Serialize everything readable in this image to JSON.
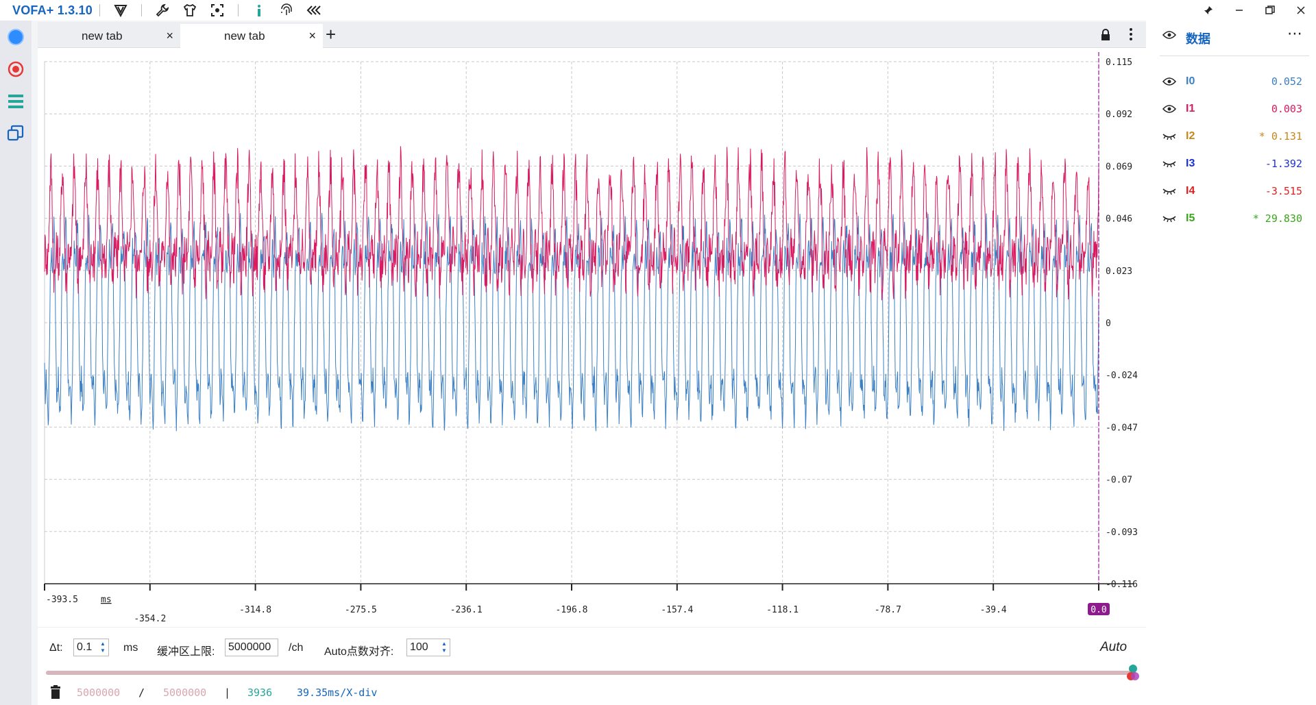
{
  "app": {
    "title": "VOFA+ 1.3.10"
  },
  "toolbar": {
    "icons": [
      "logo-v-icon",
      "wrench-icon",
      "shirt-icon",
      "screenshot-icon",
      "info-icon",
      "fingerprint-icon",
      "collapse-icon"
    ]
  },
  "window_controls": {
    "icons": [
      "pin-icon",
      "minimize-icon",
      "maximize-icon",
      "close-icon"
    ]
  },
  "left_sidebar": {
    "icons": [
      "connect-dot-icon",
      "record-icon",
      "list-icon",
      "windows-icon"
    ]
  },
  "tabs": [
    {
      "label": "new tab",
      "close": "×"
    },
    {
      "label": "new tab",
      "close": "×"
    }
  ],
  "tab_add": "+",
  "tabbar_right": {
    "icons": [
      "lock-icon",
      "more-vertical-icon"
    ]
  },
  "colors": {
    "accent": "#1565c0",
    "i0": "#3b7fc4",
    "i1": "#d81b60",
    "marker": "#8e1b8e",
    "teal": "#26a69a"
  },
  "chart_data": {
    "type": "line",
    "title": "",
    "xlabel": "",
    "x_unit_label": "ms",
    "xlim": [
      -393.5,
      0.0
    ],
    "ylim": [
      -0.116,
      0.115
    ],
    "x_tick_labels": [
      "-393.5",
      "-354.2",
      "-314.8",
      "-275.5",
      "-236.1",
      "-196.8",
      "-157.4",
      "-118.1",
      "-78.7",
      "-39.4",
      "0.0"
    ],
    "y_tick_labels": [
      "0.115",
      "0.092",
      "0.069",
      "0.046",
      "0.023",
      "0",
      "-0.024",
      "-0.047",
      "-0.07",
      "-0.093",
      "-0.116"
    ],
    "grid": true,
    "series": [
      {
        "name": "I0",
        "color": "#3b7fc4",
        "center": 0.0,
        "amplitude": 0.053,
        "period_ms": 4.35,
        "noise": 0.006
      },
      {
        "name": "I1",
        "color": "#d81b60",
        "center": 0.038,
        "amplitude": 0.03,
        "period_ms": 4.35,
        "noise": 0.01
      }
    ],
    "cursor_x": 0.0
  },
  "data_panel": {
    "title": "数据",
    "more": "⋯",
    "channels": [
      {
        "name": "I0",
        "value": "0.052",
        "color": "#3b7fc4",
        "visible": true
      },
      {
        "name": "I1",
        "value": "0.003",
        "color": "#d81b60",
        "visible": true
      },
      {
        "name": "I2",
        "value": "* 0.131",
        "color": "#c9861a",
        "visible": false
      },
      {
        "name": "I3",
        "value": "-1.392",
        "color": "#1e2fd6",
        "visible": false
      },
      {
        "name": "I4",
        "value": "-3.515",
        "color": "#e02020",
        "visible": false
      },
      {
        "name": "I5",
        "value": "* 29.830",
        "color": "#3aa61a",
        "visible": false
      }
    ]
  },
  "controls": {
    "dt_label": "Δt:",
    "dt_value": "0.1",
    "dt_unit": "ms",
    "buffer_label": "缓冲区上限:",
    "buffer_value": "5000000",
    "buffer_unit": "/ch",
    "auto_align_label": "Auto点数对齐:",
    "auto_align_value": "100",
    "auto_label": "Auto",
    "slider_fraction": 1.0
  },
  "status": {
    "used": "5000000",
    "sep1": "/",
    "total": "5000000",
    "sep2": "|",
    "count": "3936",
    "scale": "39.35ms/X-div"
  }
}
